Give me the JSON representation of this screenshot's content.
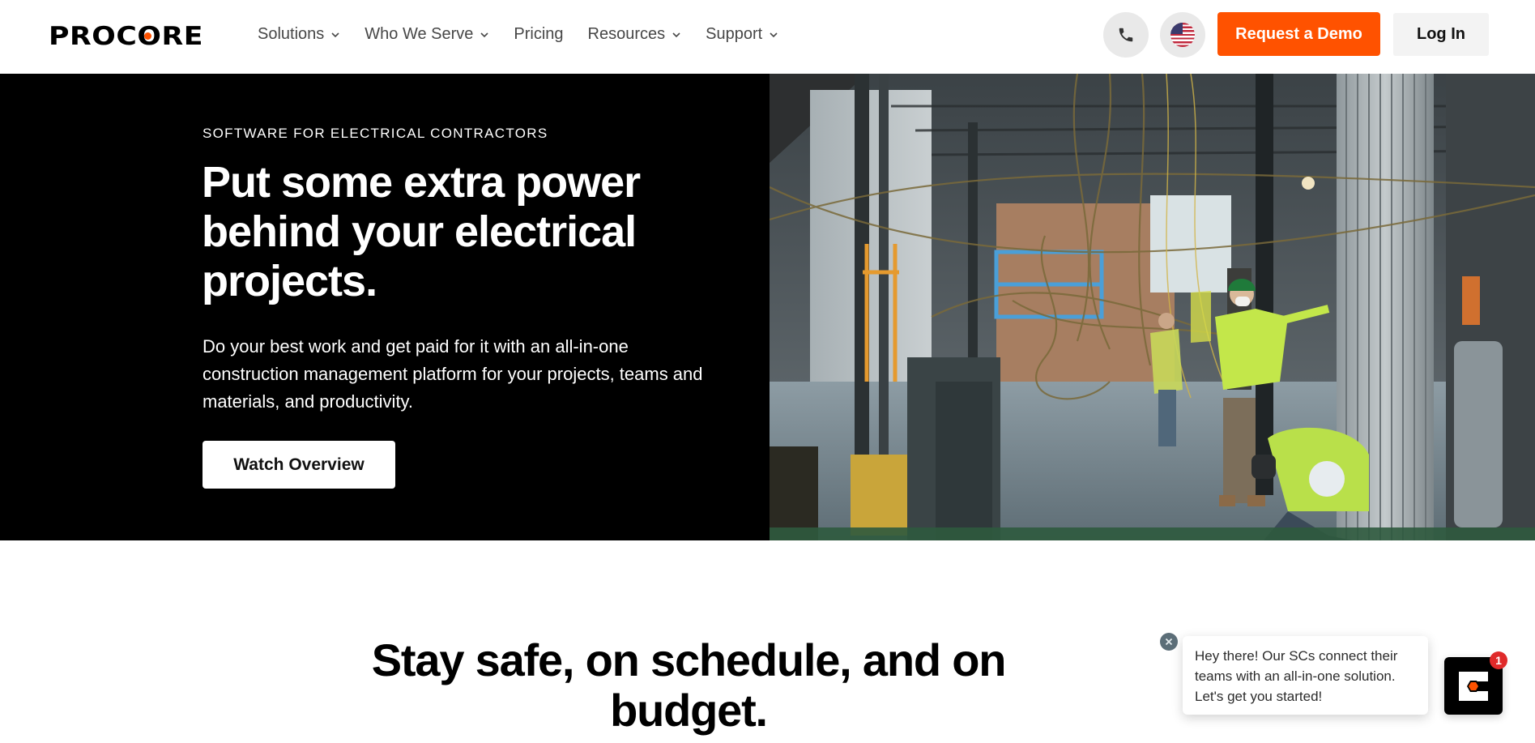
{
  "header": {
    "logo_text": "PROCORE",
    "nav": [
      {
        "label": "Solutions",
        "has_dropdown": true
      },
      {
        "label": "Who We Serve",
        "has_dropdown": true
      },
      {
        "label": "Pricing",
        "has_dropdown": false
      },
      {
        "label": "Resources",
        "has_dropdown": true
      },
      {
        "label": "Support",
        "has_dropdown": true
      }
    ],
    "phone_icon": "phone-icon",
    "region_icon": "us-flag-icon",
    "request_demo_label": "Request a Demo",
    "login_label": "Log In"
  },
  "hero": {
    "eyebrow": "SOFTWARE FOR ELECTRICAL CONTRACTORS",
    "title": "Put some extra power behind your electrical projects.",
    "body": "Do your best work and get paid for it with an all-in-one construction management platform for your projects, teams and materials, and productivity.",
    "cta_label": "Watch Overview",
    "image_description": "Electrical contractors in hi-vis shirts working at a construction site with hanging cables"
  },
  "section": {
    "title": "Stay safe, on schedule, and on budget."
  },
  "chat": {
    "message": "Hey there! Our SCs connect their teams with an all-in-one solution. Let's get you started!",
    "badge_count": "1",
    "close_icon": "close-icon",
    "launcher_icon": "procore-chat-icon"
  },
  "colors": {
    "brand_orange": "#ff5200",
    "hero_bg": "#000000",
    "nav_text": "#474747",
    "badge_red": "#e02a2a"
  }
}
